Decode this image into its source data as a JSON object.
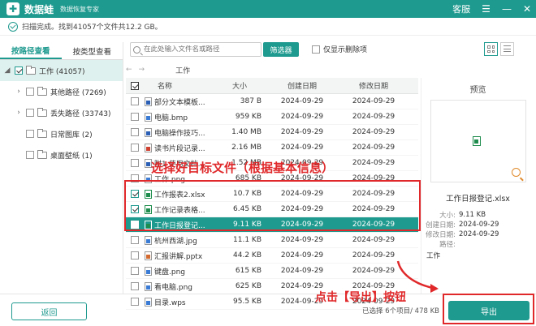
{
  "app": {
    "title": "数据蛙",
    "subtitle": "数据恢复专家",
    "logo_glyph": "✚"
  },
  "titlebar": {
    "service": "客服",
    "menu": "☰",
    "minimize": "—",
    "close": "✕"
  },
  "status": {
    "text": "扫描完成。找到41057个文件共12.2 GB。"
  },
  "left_tabs": [
    {
      "label": "按路径查看"
    },
    {
      "label": "按类型查看"
    }
  ],
  "tree": [
    {
      "label": "工作 (41057)",
      "arrow": "◢",
      "checked": true,
      "selected": true
    },
    {
      "label": "其他路径 (7269)",
      "arrow": "›",
      "checked": false
    },
    {
      "label": "丢失路径 (33743)",
      "arrow": "›",
      "checked": false
    },
    {
      "label": "日常图库 (2)",
      "arrow": "",
      "checked": false
    },
    {
      "label": "桌面壁纸 (1)",
      "arrow": "",
      "checked": false
    }
  ],
  "search": {
    "placeholder": "在此处输入文件名或路径"
  },
  "filter_button": "筛选器",
  "only_deleted": "仅显示删除项",
  "nav": {
    "back": "←",
    "forward": "→",
    "crumb": "工作"
  },
  "table": {
    "headers": {
      "name": "名称",
      "size": "大小",
      "created": "创建日期",
      "modified": "修改日期"
    },
    "rows": [
      {
        "name": "部分文本模板...",
        "size": "387 B",
        "created": "2024-09-29",
        "modified": "2024-09-29",
        "type": "doc",
        "checked": false
      },
      {
        "name": "电脑.bmp",
        "size": "959 KB",
        "created": "2024-09-29",
        "modified": "2024-09-29",
        "type": "bmp",
        "checked": false
      },
      {
        "name": "电脑操作技巧...",
        "size": "1.40 MB",
        "created": "2024-09-29",
        "modified": "2024-09-29",
        "type": "doc",
        "checked": false
      },
      {
        "name": "读书片段记录...",
        "size": "2.16 MB",
        "created": "2024-09-29",
        "modified": "2024-09-29",
        "type": "pdf",
        "checked": false
      },
      {
        "name": "附1 使用文档...",
        "size": "1.52 MB",
        "created": "2024-09-29",
        "modified": "2024-09-29",
        "type": "doc",
        "checked": false
      },
      {
        "name": "工作.png",
        "size": "685 KB",
        "created": "2024-09-29",
        "modified": "2024-09-29",
        "type": "png",
        "checked": false
      },
      {
        "name": "工作报表2.xlsx",
        "size": "10.7 KB",
        "created": "2024-09-29",
        "modified": "2024-09-29",
        "type": "xls",
        "checked": true
      },
      {
        "name": "工作记录表格...",
        "size": "6.45 KB",
        "created": "2024-09-29",
        "modified": "2024-09-29",
        "type": "xls",
        "checked": true
      },
      {
        "name": "工作日报登记...",
        "size": "9.11 KB",
        "created": "2024-09-29",
        "modified": "2024-09-29",
        "type": "xls",
        "checked": true,
        "selected": true
      },
      {
        "name": "杭州西湖.jpg",
        "size": "11.1 KB",
        "created": "2024-09-29",
        "modified": "2024-09-29",
        "type": "jpg",
        "checked": false
      },
      {
        "name": "汇报讲解.pptx",
        "size": "44.2 KB",
        "created": "2024-09-29",
        "modified": "2024-09-29",
        "type": "ppt",
        "checked": false
      },
      {
        "name": "键盘.png",
        "size": "615 KB",
        "created": "2024-09-29",
        "modified": "2024-09-29",
        "type": "png",
        "checked": false
      },
      {
        "name": "看电脑.png",
        "size": "625 KB",
        "created": "2024-09-29",
        "modified": "2024-09-29",
        "type": "png",
        "checked": false
      },
      {
        "name": "目录.wps",
        "size": "95.5 KB",
        "created": "2024-09-29",
        "modified": "2024-09-29",
        "type": "wps",
        "checked": false
      }
    ]
  },
  "preview": {
    "title": "预览",
    "file_name": "工作日报登记.xlsx",
    "meta": [
      {
        "k": "大小:",
        "v": "9.11 KB"
      },
      {
        "k": "创建日期:",
        "v": "2024-09-29"
      },
      {
        "k": "修改日期:",
        "v": "2024-09-29"
      },
      {
        "k": "路径:",
        "v": ""
      }
    ],
    "path_value": "工作"
  },
  "footer": {
    "back": "返回",
    "selected_info": "已选择 6个项目/ 478 KB",
    "export": "导出"
  },
  "annotations": {
    "select_hint": "选择好目标文件（根据基本信息）",
    "export_hint": "点击【导出】按钮"
  },
  "colors": {
    "accent": "#1f9a8f",
    "annotation": "#e0282a"
  }
}
